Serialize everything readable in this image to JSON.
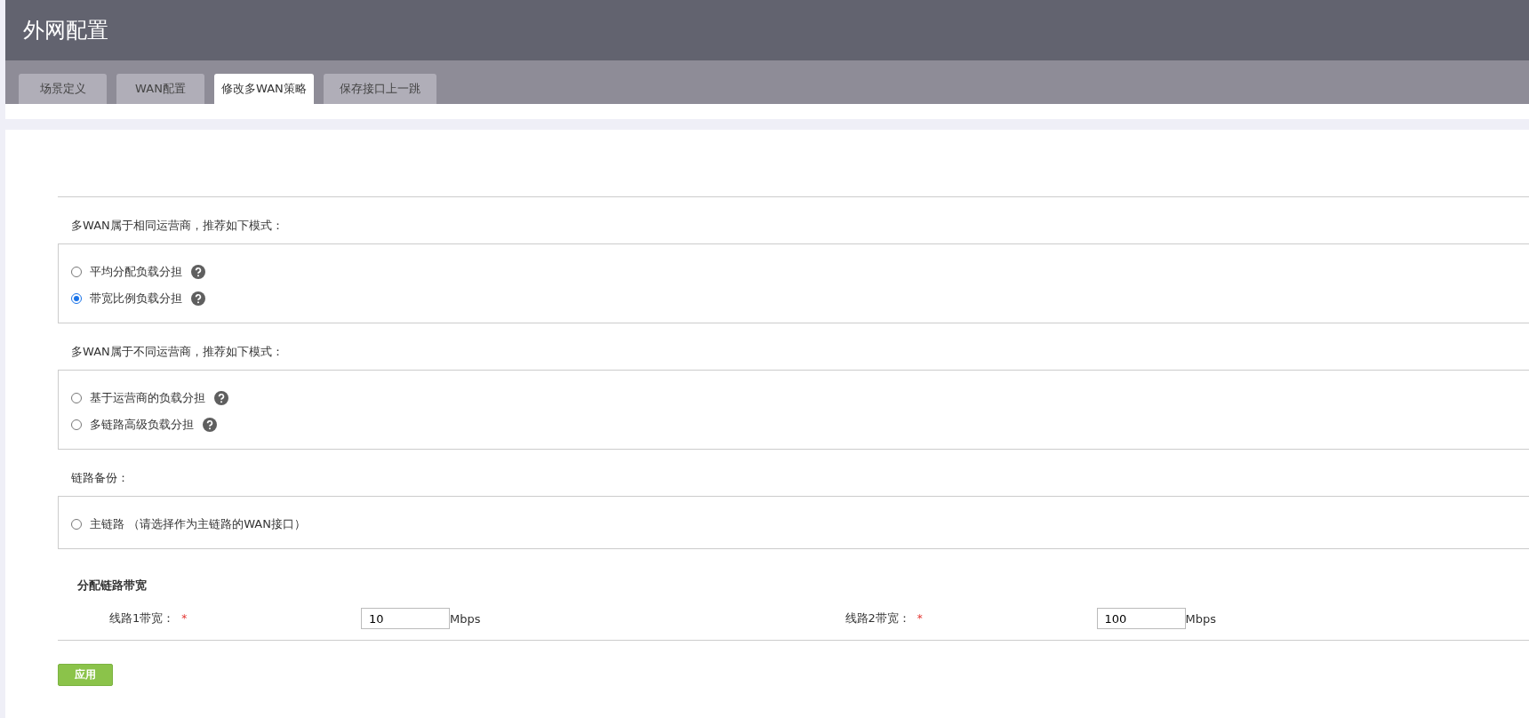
{
  "header": {
    "title": "外网配置"
  },
  "tabs": [
    {
      "label": "场景定义",
      "selected": false
    },
    {
      "label": "WAN配置",
      "selected": false
    },
    {
      "label": "修改多WAN策略",
      "selected": true
    },
    {
      "label": "保存接口上一跳",
      "selected": false
    }
  ],
  "groups": [
    {
      "label": "多WAN属于相同运营商，推荐如下模式：",
      "options": [
        {
          "label": "平均分配负载分担",
          "selected": false,
          "help": true
        },
        {
          "label": "带宽比例负载分担",
          "selected": true,
          "help": true
        }
      ]
    },
    {
      "label": "多WAN属于不同运营商，推荐如下模式：",
      "options": [
        {
          "label": "基于运营商的负载分担",
          "selected": false,
          "help": true
        },
        {
          "label": "多链路高级负载分担",
          "selected": false,
          "help": true
        }
      ]
    },
    {
      "label": "链路备份：",
      "options": [
        {
          "label": "主链路 （请选择作为主链路的WAN接口）",
          "selected": false,
          "help": false
        }
      ]
    }
  ],
  "bandwidth": {
    "title": "分配链路带宽",
    "fields": [
      {
        "label": "线路1带宽：",
        "required": true,
        "mark": "*",
        "value": "10",
        "unit": "Mbps"
      },
      {
        "label": "线路2带宽：",
        "required": true,
        "mark": "*",
        "value": "100",
        "unit": "Mbps"
      }
    ]
  },
  "apply_button": "应用"
}
